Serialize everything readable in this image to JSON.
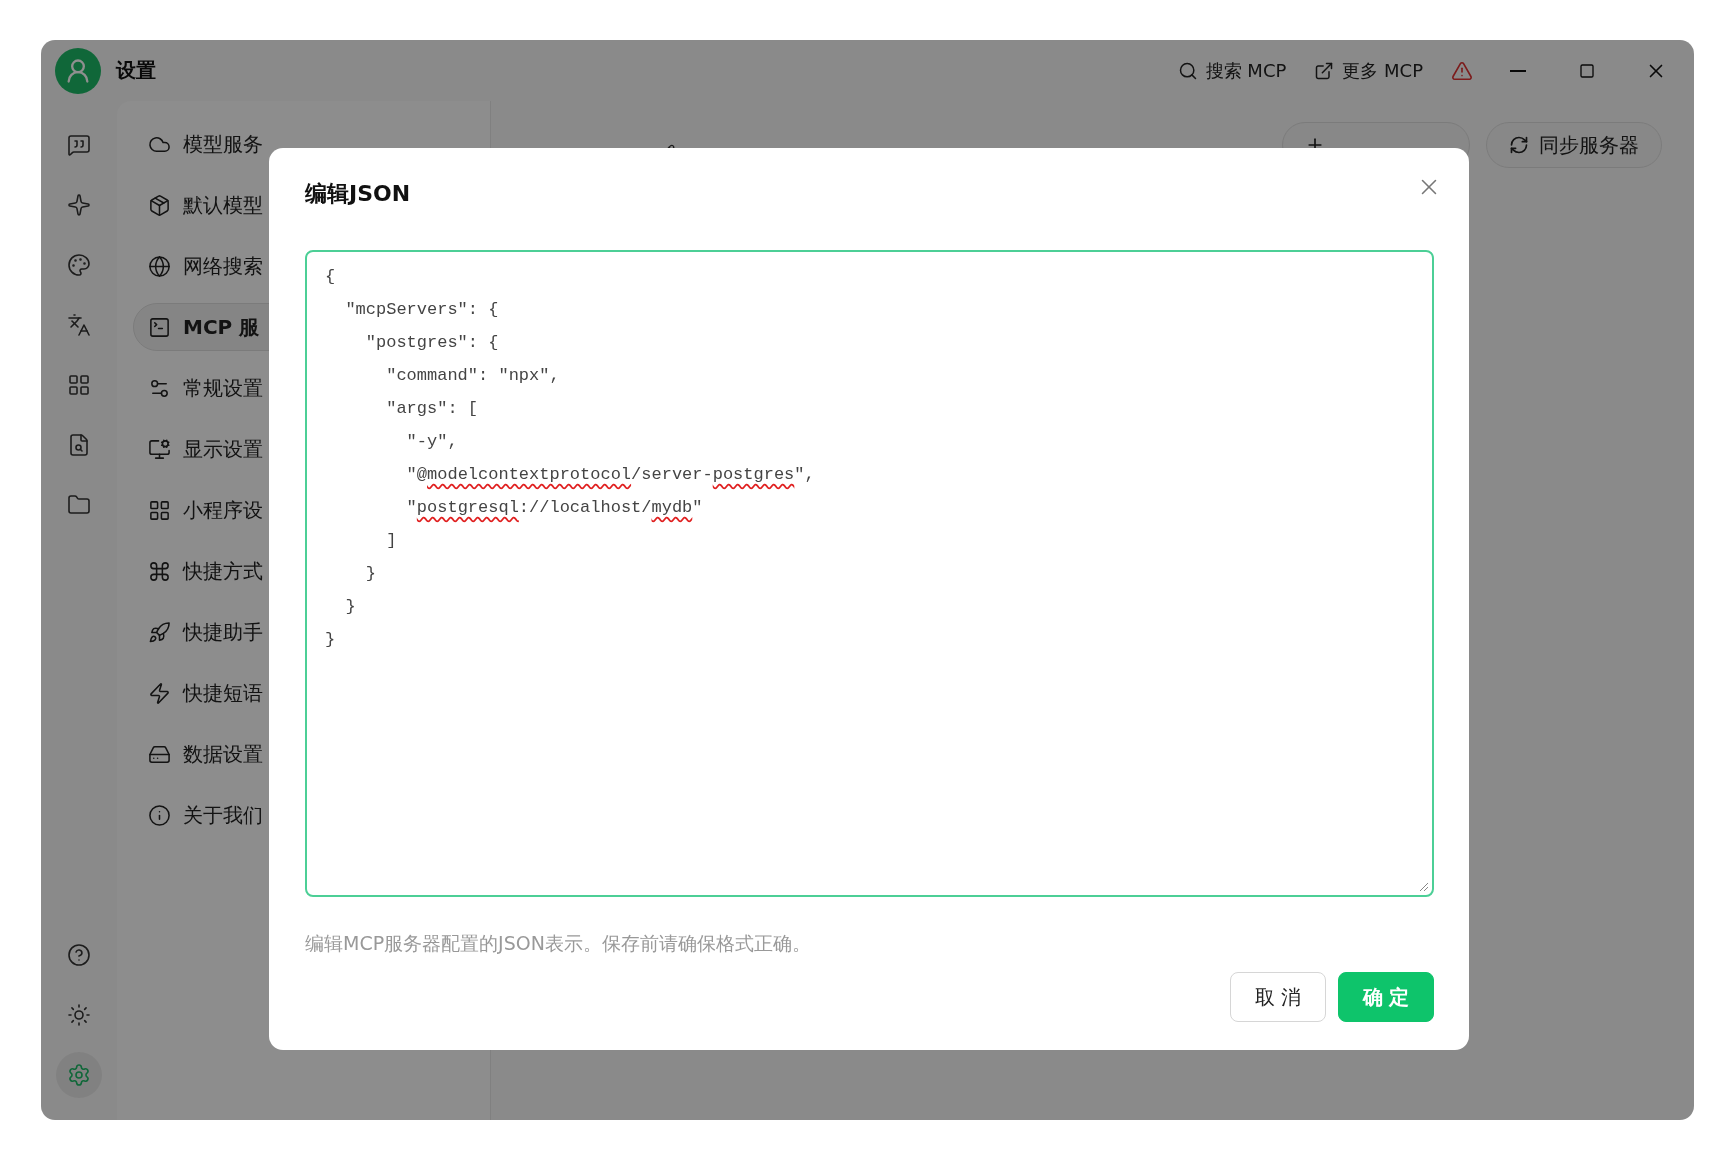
{
  "window": {
    "title": "设置"
  },
  "toolbar": [
    {
      "label": "搜索 MCP"
    },
    {
      "label": "更多 MCP"
    }
  ],
  "rail": {
    "top_items": [
      {
        "selected": false
      },
      {
        "selected": false
      },
      {
        "selected": false
      },
      {
        "selected": false
      },
      {
        "selected": false
      },
      {
        "selected": false
      },
      {
        "selected": false
      }
    ],
    "bottom_items": [
      {
        "selected": false
      },
      {
        "selected": false
      },
      {
        "selected": true
      }
    ]
  },
  "nav": {
    "items": [
      {
        "label": "模型服务",
        "selected": false
      },
      {
        "label": "默认模型",
        "selected": false
      },
      {
        "label": "网络搜索",
        "selected": false
      },
      {
        "label": "MCP 服",
        "selected": true
      },
      {
        "label": "常规设置",
        "selected": false
      },
      {
        "label": "显示设置",
        "selected": false
      },
      {
        "label": "小程序设",
        "selected": false
      },
      {
        "label": "快捷方式",
        "selected": false
      },
      {
        "label": "快捷助手",
        "selected": false
      },
      {
        "label": "快捷短语",
        "selected": false
      },
      {
        "label": "数据设置",
        "selected": false
      },
      {
        "label": "关于我们",
        "selected": false
      }
    ]
  },
  "main": {
    "buttons": [
      {
        "kind": "add"
      },
      {
        "kind": "sync",
        "label": "同步服务器"
      }
    ]
  },
  "dialog": {
    "title": "编辑JSON",
    "editor": {
      "lines": [
        {
          "text": "{"
        },
        {
          "text": "  \"mcpServers\": {"
        },
        {
          "text": "    \"postgres\": {"
        },
        {
          "text": "      \"command\": \"npx\","
        },
        {
          "text": "      \"args\": ["
        },
        {
          "text": "        \"-y\","
        },
        {
          "parts": [
            {
              "text": "        \"@",
              "misspelled": false
            },
            {
              "text": "modelcontextprotocol",
              "misspelled": true
            },
            {
              "text": "/server-",
              "misspelled": false
            },
            {
              "text": "postgres",
              "misspelled": true
            },
            {
              "text": "\",",
              "misspelled": false
            }
          ]
        },
        {
          "parts": [
            {
              "text": "        \"",
              "misspelled": false
            },
            {
              "text": "postgresql",
              "misspelled": true
            },
            {
              "text": "://localhost/",
              "misspelled": false
            },
            {
              "text": "mydb",
              "misspelled": true
            },
            {
              "text": "\"",
              "misspelled": false
            }
          ]
        },
        {
          "text": "      ]"
        },
        {
          "text": "    }"
        },
        {
          "text": "  }"
        },
        {
          "text": "}"
        }
      ]
    },
    "hint": "编辑MCP服务器配置的JSON表示。保存前请确保格式正确。",
    "buttons": [
      {
        "label": "取 消",
        "kind": "default"
      },
      {
        "label": "确 定",
        "kind": "primary"
      }
    ]
  }
}
